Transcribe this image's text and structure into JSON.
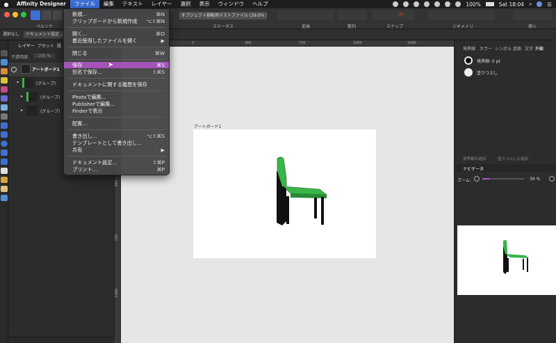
{
  "menubar": {
    "app_name": "Affinity Designer",
    "items": [
      "ファイル",
      "編集",
      "テキスト",
      "レイヤー",
      "選択",
      "表示",
      "ウィンドウ",
      "ヘルプ"
    ],
    "battery": "100%",
    "clock": "Sat 18:04"
  },
  "toolbar": {
    "doc_tab": "オブジェクト移動用テストファイル (39.0% ✕",
    "labels": {
      "status": "ステータス",
      "transform": "変換",
      "arrange": "整列",
      "snap": "スナップ",
      "geometry": "ジオメトリ",
      "insert": "挿入"
    }
  },
  "context": {
    "persona": "ペルソナ",
    "select_label": "選択なし",
    "doc_settings": "ドキュメント設定..."
  },
  "layers_panel": {
    "tabs": [
      "レイヤー",
      "アセット",
      "履"
    ],
    "opacity_label": "不透明度:",
    "opacity_value": "100 %",
    "rows": [
      {
        "label": "アートボード1",
        "kind": "artboard"
      },
      {
        "label": "(グループ)",
        "kind": "group"
      },
      {
        "label": "(グループ)",
        "kind": "group"
      },
      {
        "label": "(グループ)",
        "kind": "group"
      }
    ]
  },
  "ruler": {
    "top": [
      "0",
      "360",
      "720",
      "1080",
      "1440"
    ],
    "left": [
      "360",
      "720",
      "1080"
    ]
  },
  "canvas": {
    "artboard_label": "アートボード1"
  },
  "right_panel": {
    "tabs": [
      "塗り",
      "境界線",
      "カラー",
      "シンボル",
      "変換",
      "文字",
      "外観"
    ],
    "stroke_row": "境界線: 0 pt",
    "fill_row": "塗りつぶし",
    "add_stroke": "境界線の追加",
    "add_fill": "塗りつぶしの追加",
    "navigator_tab": "ナビゲータ",
    "zoom_label": "ズーム:",
    "zoom_value": "39 %"
  },
  "file_menu": {
    "items": [
      {
        "label": "新規...",
        "shortcut": "⌘N"
      },
      {
        "label": "クリップボードから新規作成",
        "shortcut": "⌥⇧⌘N"
      },
      {
        "label": "開く...",
        "shortcut": "⌘O"
      },
      {
        "label": "最近使用したファイルを開く",
        "shortcut": "▶"
      },
      {
        "label": "閉じる",
        "shortcut": "⌘W"
      },
      {
        "label": "保存",
        "shortcut": "⌘S"
      },
      {
        "label": "別名で保存...",
        "shortcut": "⇧⌘S"
      },
      {
        "label": "ドキュメントに関する履歴を保存",
        "shortcut": ""
      },
      {
        "label": "Photoで編集...",
        "shortcut": ""
      },
      {
        "label": "Publisherで編集...",
        "shortcut": ""
      },
      {
        "label": "Finderで表示",
        "shortcut": ""
      },
      {
        "label": "配置...",
        "shortcut": ""
      },
      {
        "label": "書き出し...",
        "shortcut": "⌥⇧⌘S"
      },
      {
        "label": "テンプレートとして書き出し...",
        "shortcut": ""
      },
      {
        "label": "共有",
        "shortcut": "▶"
      },
      {
        "label": "ドキュメント設定...",
        "shortcut": "⇧⌘P"
      },
      {
        "label": "プリント...",
        "shortcut": "⌘P"
      }
    ]
  },
  "colors": {
    "accent": "#3d6fd6",
    "highlight": "#a354b6",
    "chair_green": "#3ab54a"
  }
}
